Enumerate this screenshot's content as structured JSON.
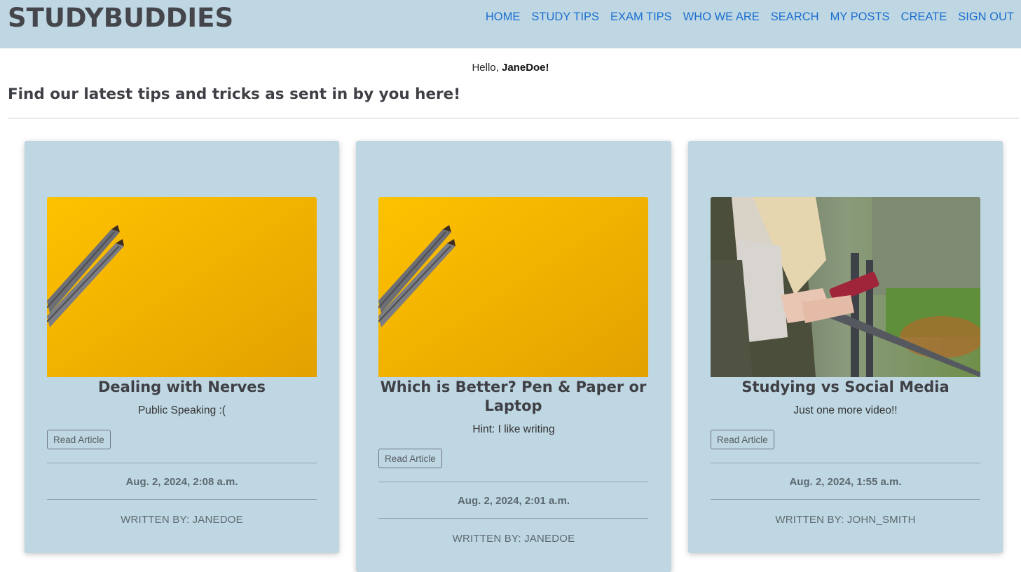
{
  "header": {
    "brand": "STUDYBUDDIES",
    "nav": [
      "HOME",
      "STUDY TIPS",
      "EXAM TIPS",
      "WHO WE ARE",
      "SEARCH",
      "MY POSTS",
      "CREATE",
      "SIGN OUT"
    ]
  },
  "greeting": {
    "prefix": "Hello, ",
    "username": "JaneDoe!"
  },
  "headline": "Find our latest tips and tricks as sent in by you here!",
  "read_label": "Read Article",
  "posts": [
    {
      "title": "Dealing with Nerves",
      "subtitle": "Public Speaking :(",
      "date": "Aug. 2, 2024, 2:08 a.m.",
      "author": "WRITTEN BY: JANEDOE",
      "image": "yellow-pencils"
    },
    {
      "title": "Which is Better? Pen & Paper or Laptop",
      "subtitle": "Hint: I like writing",
      "date": "Aug. 2, 2024, 2:01 a.m.",
      "author": "WRITTEN BY: JANEDOE",
      "image": "yellow-pencils"
    },
    {
      "title": "Studying vs Social Media",
      "subtitle": "Just one more video!!",
      "date": "Aug. 2, 2024, 1:55 a.m.",
      "author": "WRITTEN BY: JOHN_SMITH",
      "image": "person-phone"
    }
  ],
  "colors": {
    "header_bg": "#bfd7e2",
    "card_bg": "#bfd7e2",
    "nav_link": "#1a6fd1",
    "text_dark": "#3f4046"
  }
}
